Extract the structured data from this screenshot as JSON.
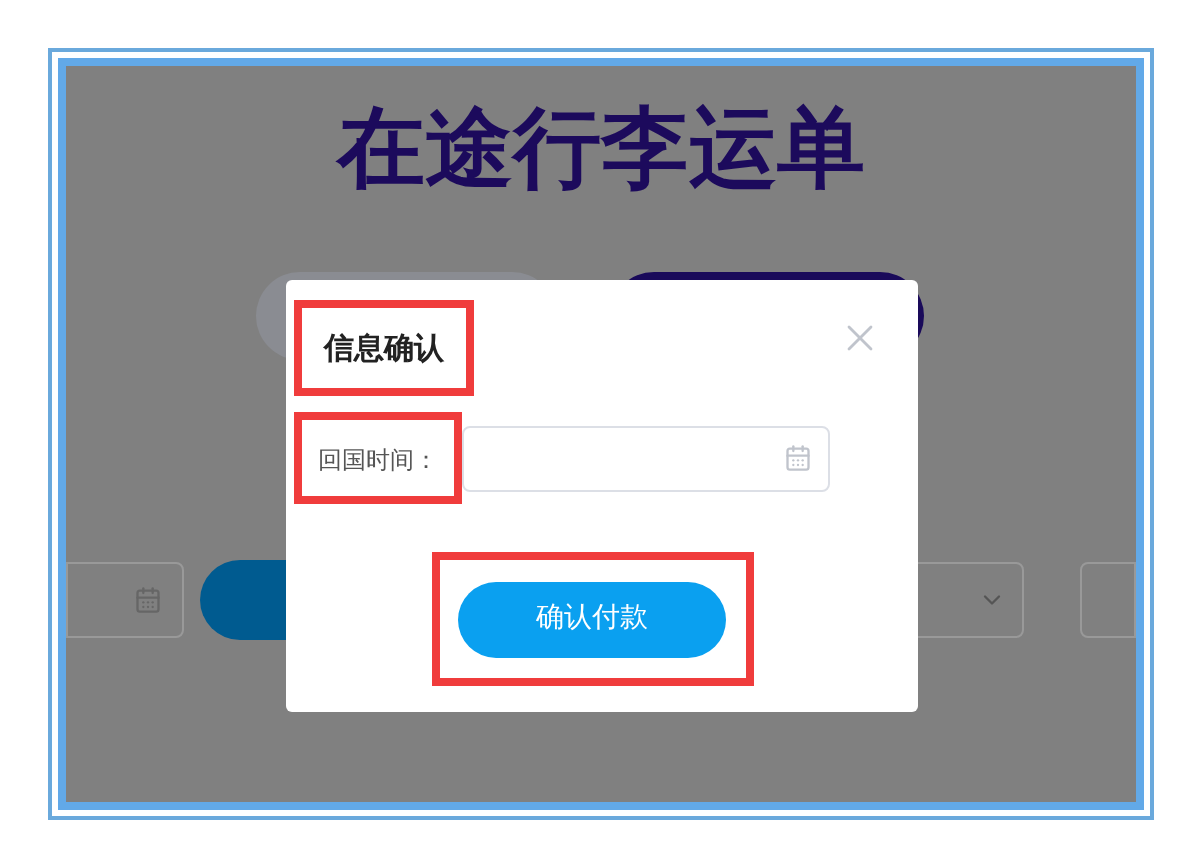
{
  "page": {
    "title": "在途行李运单"
  },
  "dialog": {
    "title": {
      "text": "信息确认",
      "highlighted": true
    },
    "field": {
      "label": "回国时间：",
      "highlighted": true
    },
    "button": {
      "label": "确认付款",
      "highlighted": true
    }
  }
}
